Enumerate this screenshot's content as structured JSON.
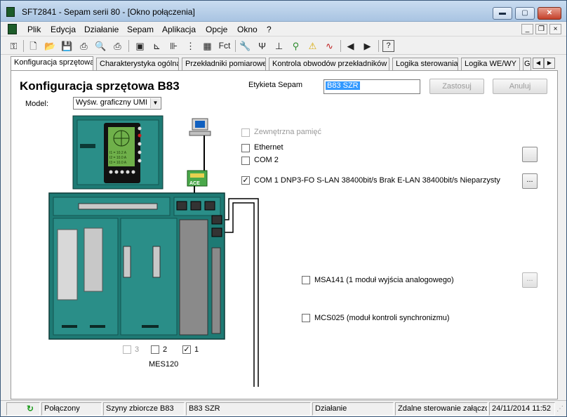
{
  "window": {
    "title": "SFT2841 - Sepam serii 80 - [Okno połączenia]",
    "controls": {
      "minimize": "▬",
      "maximize": "▢",
      "close": "✕"
    }
  },
  "menu": {
    "items": [
      "Plik",
      "Edycja",
      "Działanie",
      "Sepam",
      "Aplikacja",
      "Opcje",
      "Okno",
      "?"
    ],
    "mdi_controls": [
      "_",
      "❐",
      "×"
    ]
  },
  "toolbar": {
    "fct_label": "Fct"
  },
  "tabs": {
    "items": [
      "Konfiguracja sprzętowa",
      "Charakterystyka ogólna",
      "Przekładniki pomiarowe",
      "Kontrola obwodów przekładników",
      "Logika sterowania",
      "Logika WE/WY",
      "G"
    ],
    "scroll_left": "◀",
    "scroll_right": "▶"
  },
  "page": {
    "heading": "Konfiguracja sprzętowa  B83",
    "model_label": "Model:",
    "model_value": "Wyśw. graficzny UMI",
    "label_field_label": "Etykieta Sepam",
    "label_field_value": "B83 SZR",
    "apply_button": "Zastosuj",
    "cancel_button": "Anuluj",
    "options": {
      "external_memory": {
        "label": "Zewnętrzna pamięć",
        "checked": false,
        "enabled": false
      },
      "ethernet": {
        "label": "Ethernet",
        "checked": false,
        "enabled": true
      },
      "com2": {
        "label": "COM 2",
        "checked": false,
        "enabled": true
      },
      "com1": {
        "label": "COM 1  DNP3-FO   S-LAN 38400bit/s  Brak  E-LAN 38400bit/s  Nieparzysty",
        "checked": true,
        "enabled": true
      },
      "msa141": {
        "label": "MSA141 (1 moduł wyjścia analogowego)",
        "checked": false
      },
      "mcs025": {
        "label": "MCS025 (moduł kontroli synchronizmu)",
        "checked": false
      }
    },
    "ellipsis": "...",
    "mes_slots": [
      {
        "label": "3",
        "checked": false,
        "enabled": false
      },
      {
        "label": "2",
        "checked": false,
        "enabled": true
      },
      {
        "label": "1",
        "checked": true,
        "enabled": true
      }
    ],
    "mes_label": "MES120",
    "device_texts": {
      "ace_label": "ACE",
      "display_lines": [
        "I1 = 10.2 A",
        "I2 = 10.0 A",
        "I3 = 10.0 A"
      ]
    }
  },
  "status": {
    "connection": "Połączony",
    "busbar": "Szyny zbiorcze B83",
    "sepam_label": "B83 SZR",
    "mode": "Działanie",
    "remote": "Zdalne sterowanie załączone",
    "datetime": "24/11/2014  11:52"
  }
}
